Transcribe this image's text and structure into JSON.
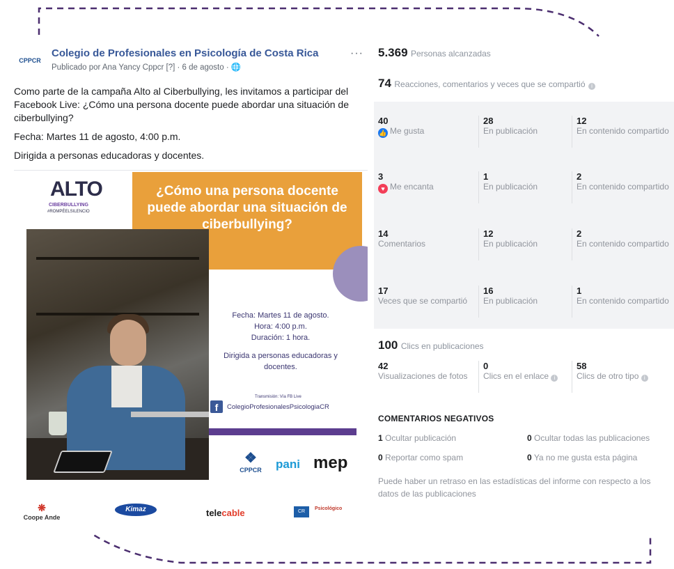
{
  "colors": {
    "accent_dashed": "#4b2e6f",
    "fb_link": "#385898",
    "orange": "#e9a03b",
    "purple": "#5c3d8f"
  },
  "post": {
    "page_name": "Colegio de Profesionales en Psicología de Costa Rica",
    "meta": "Publicado por Ana Yancy Cppcr [?] · 6 de agosto · ",
    "more": "···",
    "paragraphs": [
      "Como parte de la campaña Alto al Ciberbullying, les invitamos a participar del Facebook Live: ¿Cómo una persona docente puede abordar una situación de ciberbullying?",
      "Fecha: Martes 11 de agosto, 4:00 p.m.",
      "Dirigida a personas educadoras y docentes."
    ],
    "image": {
      "alto": "ALTO",
      "alto_sub": "CIBERBULLYING",
      "alto_tag": "#ROMPÉELSILENCIO",
      "headline": "¿Cómo una persona docente puede abordar una situación de ciberbullying?",
      "info_lines": [
        "Fecha: Martes 11 de agosto.",
        "Hora: 4:00 p.m.",
        "Duración: 1 hora."
      ],
      "audience": "Dirigida a personas educadoras y docentes.",
      "transmission": "Transmisión: Vía FB Live",
      "fb_handle": "ColegioProfesionalesPsicologiaCR",
      "logos": {
        "cppcr": "CPPCR",
        "pani": "pani",
        "mep": "mep",
        "coope": "Coope Ande",
        "kimaz": "Kimaz",
        "telecable": [
          "tele",
          "cable"
        ],
        "cr": "CR",
        "psico": "Psicológico"
      }
    }
  },
  "insights": {
    "reach_value": "5.369",
    "reach_label": "Personas alcanzadas",
    "reactions_value": "74",
    "reactions_label": "Reacciones, comentarios y veces que se compartió",
    "rows": [
      {
        "total": "40",
        "label": "Me gusta",
        "icon": "like",
        "on_post": "28",
        "on_post_label": "En publicación",
        "on_shares": "12",
        "on_shares_label": "En contenido compartido"
      },
      {
        "total": "3",
        "label": "Me encanta",
        "icon": "love",
        "on_post": "1",
        "on_post_label": "En publicación",
        "on_shares": "2",
        "on_shares_label": "En contenido compartido"
      },
      {
        "total": "14",
        "label": "Comentarios",
        "icon": "",
        "on_post": "12",
        "on_post_label": "En publicación",
        "on_shares": "2",
        "on_shares_label": "En contenido compartido"
      },
      {
        "total": "17",
        "label": "Veces que se compartió",
        "icon": "",
        "on_post": "16",
        "on_post_label": "En publicación",
        "on_shares": "1",
        "on_shares_label": "En contenido compartido"
      }
    ],
    "clicks_value": "100",
    "clicks_label": "Clics en publicaciones",
    "clicks": [
      {
        "value": "42",
        "label": "Visualizaciones de fotos"
      },
      {
        "value": "0",
        "label": "Clics en el enlace"
      },
      {
        "value": "58",
        "label": "Clics de otro tipo"
      }
    ],
    "negative_title": "COMENTARIOS NEGATIVOS",
    "negative": [
      {
        "value": "1",
        "label": "Ocultar publicación"
      },
      {
        "value": "0",
        "label": "Ocultar todas las publicaciones"
      },
      {
        "value": "0",
        "label": "Reportar como spam"
      },
      {
        "value": "0",
        "label": "Ya no me gusta esta página"
      }
    ],
    "disclaimer": "Puede haber un retraso en las estadísticas del informe con respecto a los datos de las publicaciones",
    "info_glyph": "i"
  }
}
